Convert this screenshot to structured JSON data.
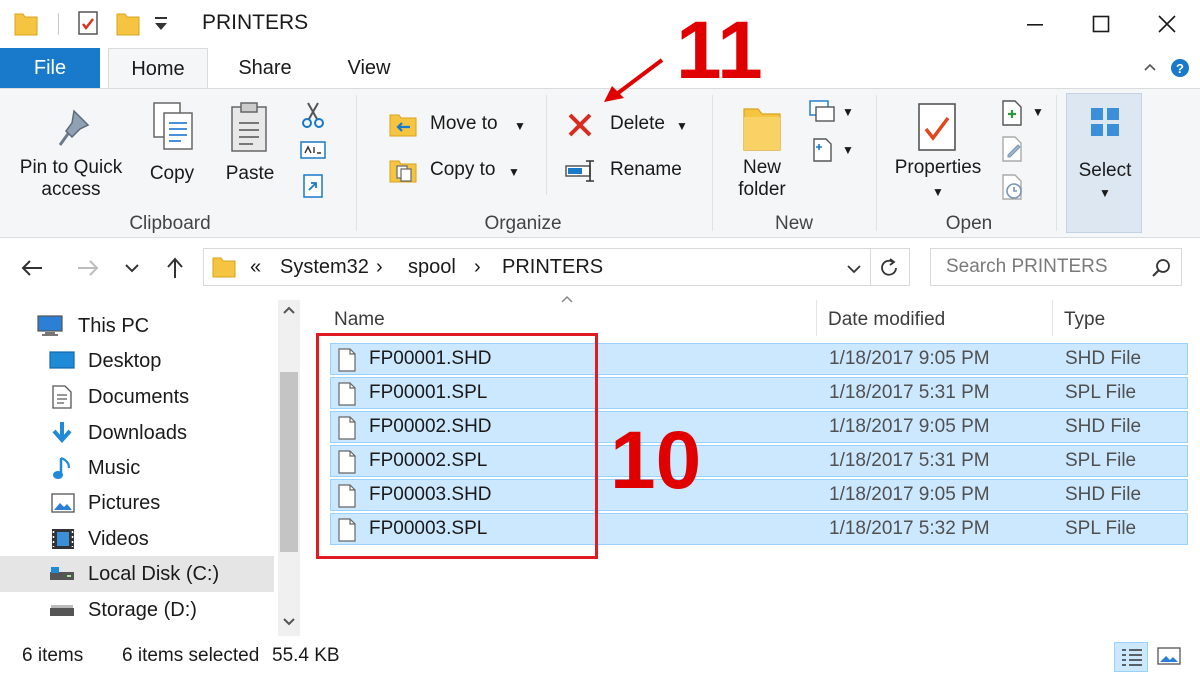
{
  "window": {
    "title": "PRINTERS",
    "controls": {
      "minimize": "minimize-icon",
      "maximize": "maximize-icon",
      "close": "close-icon"
    }
  },
  "tabs": {
    "file": "File",
    "home": "Home",
    "share": "Share",
    "view": "View"
  },
  "ribbon": {
    "clipboard": {
      "pin_label_1": "Pin to Quick",
      "pin_label_2": "access",
      "copy": "Copy",
      "paste": "Paste",
      "group": "Clipboard"
    },
    "organize": {
      "move_to": "Move to",
      "copy_to": "Copy to",
      "delete": "Delete",
      "rename": "Rename",
      "group": "Organize"
    },
    "new": {
      "new_folder_1": "New",
      "new_folder_2": "folder",
      "group": "New"
    },
    "open": {
      "properties": "Properties",
      "group": "Open"
    },
    "select": {
      "label": "Select"
    }
  },
  "address": {
    "overflow": "«",
    "crumbs": [
      "System32",
      "spool",
      "PRINTERS"
    ],
    "separator": "›",
    "search_placeholder": "Search PRINTERS"
  },
  "nav": {
    "items": [
      {
        "label": "This PC",
        "icon": "pc-icon"
      },
      {
        "label": "Desktop",
        "icon": "desktop-icon"
      },
      {
        "label": "Documents",
        "icon": "documents-icon"
      },
      {
        "label": "Downloads",
        "icon": "download-icon"
      },
      {
        "label": "Music",
        "icon": "music-icon"
      },
      {
        "label": "Pictures",
        "icon": "pictures-icon"
      },
      {
        "label": "Videos",
        "icon": "videos-icon"
      },
      {
        "label": "Local Disk (C:)",
        "icon": "drive-icon",
        "selected": true
      },
      {
        "label": "Storage (D:)",
        "icon": "drive-icon"
      }
    ]
  },
  "files": {
    "columns": {
      "name": "Name",
      "date": "Date modified",
      "type": "Type"
    },
    "rows": [
      {
        "name": "FP00001.SHD",
        "date": "1/18/2017 9:05 PM",
        "type": "SHD File"
      },
      {
        "name": "FP00001.SPL",
        "date": "1/18/2017 5:31 PM",
        "type": "SPL File"
      },
      {
        "name": "FP00002.SHD",
        "date": "1/18/2017 9:05 PM",
        "type": "SHD File"
      },
      {
        "name": "FP00002.SPL",
        "date": "1/18/2017 5:31 PM",
        "type": "SPL File"
      },
      {
        "name": "FP00003.SHD",
        "date": "1/18/2017 9:05 PM",
        "type": "SHD File"
      },
      {
        "name": "FP00003.SPL",
        "date": "1/18/2017 5:32 PM",
        "type": "SPL File"
      }
    ]
  },
  "status": {
    "items": "6 items",
    "selected": "6 items selected",
    "size": "55.4 KB"
  },
  "annotations": {
    "step_10": "10",
    "step_11": "11"
  },
  "colors": {
    "accent": "#1979ca",
    "selection": "#cce8ff",
    "annotation_red": "#e00000"
  }
}
